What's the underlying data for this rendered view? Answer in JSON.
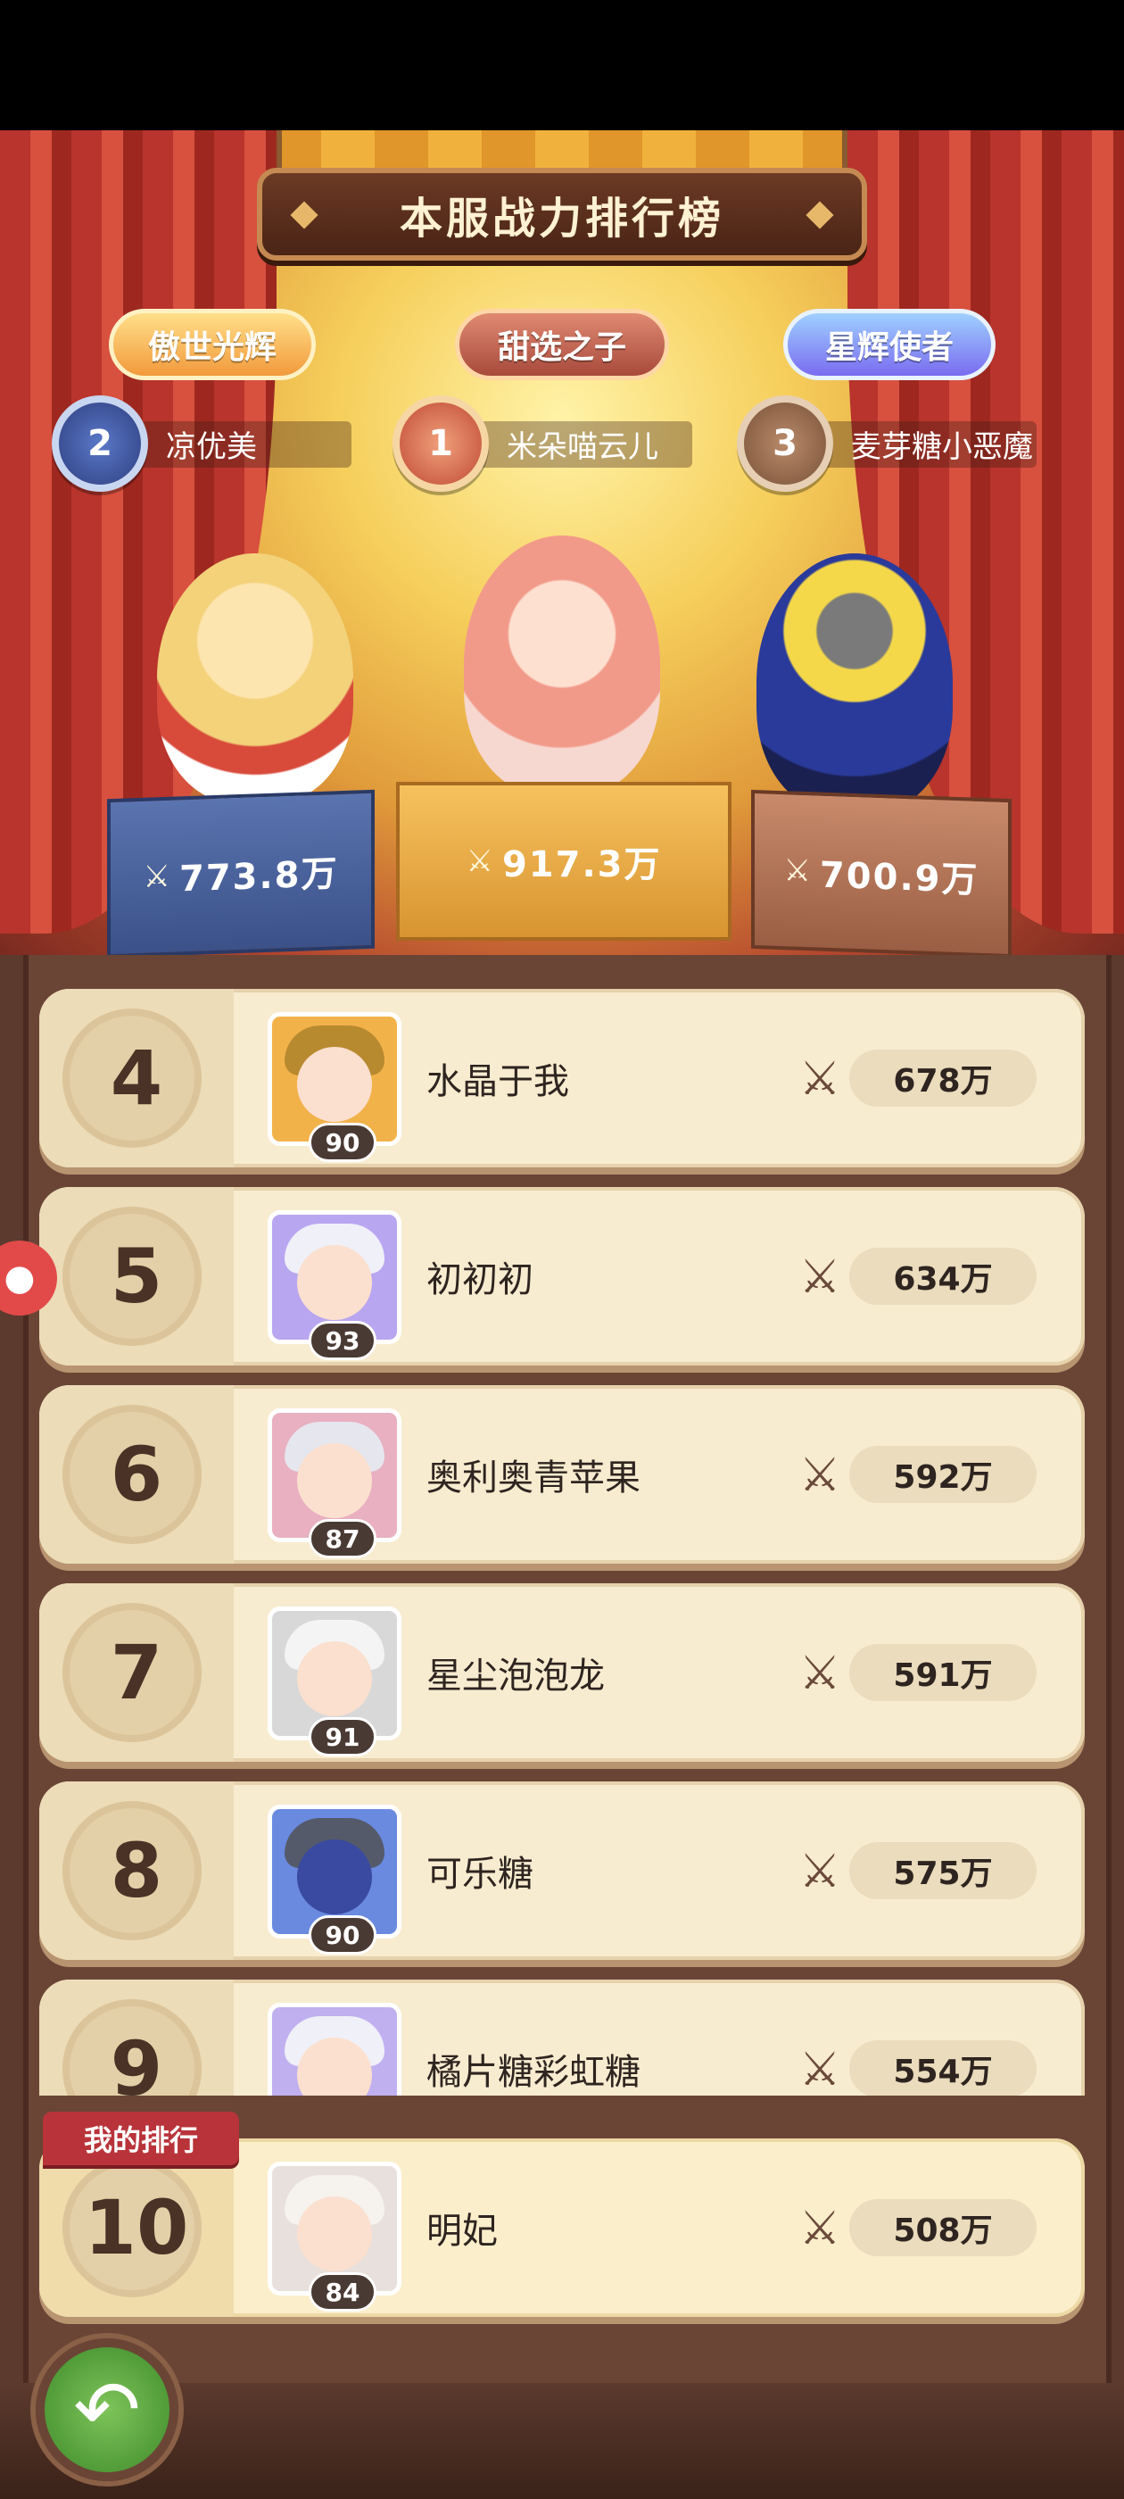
{
  "header": {
    "title": "本服战力排行榜"
  },
  "top3": {
    "badges": [
      "傲世光辉",
      "甜选之子",
      "星辉使者"
    ],
    "players": [
      {
        "rank": "2",
        "name": "凉优美",
        "power": "773.8万"
      },
      {
        "rank": "1",
        "name": "米朵喵云儿",
        "power": "917.3万"
      },
      {
        "rank": "3",
        "name": "麦芽糖小恶魔",
        "power": "700.9万"
      }
    ]
  },
  "list": [
    {
      "rank": "4",
      "name": "水晶于我",
      "level": "90",
      "power": "678万",
      "avatar_color": "#f2b24a"
    },
    {
      "rank": "5",
      "name": "初初初",
      "level": "93",
      "power": "634万",
      "avatar_color": "#b8a6f0"
    },
    {
      "rank": "6",
      "name": "奥利奥青苹果",
      "level": "87",
      "power": "592万",
      "avatar_color": "#e8b0c0"
    },
    {
      "rank": "7",
      "name": "星尘泡泡龙",
      "level": "91",
      "power": "591万",
      "avatar_color": "#d8d8d8"
    },
    {
      "rank": "8",
      "name": "可乐糖",
      "level": "90",
      "power": "575万",
      "avatar_color": "#6a8ae0"
    },
    {
      "rank": "9",
      "name": "橘片糖彩虹糖",
      "level": "",
      "power": "554万",
      "avatar_color": "#c0b0f0"
    }
  ],
  "my_rank": {
    "tag": "我的排行",
    "rank": "10",
    "name": "明妃",
    "level": "84",
    "power": "508万",
    "avatar_color": "#e8e0dc"
  },
  "icons": {
    "back": "back-arrow-icon",
    "power": "crossed-swords-icon",
    "side": "gamepad-icon"
  },
  "colors": {
    "gold": "#f6c25e",
    "silver": "#5a74b0",
    "bronze": "#9a5e44",
    "tag": "#b8343a"
  }
}
